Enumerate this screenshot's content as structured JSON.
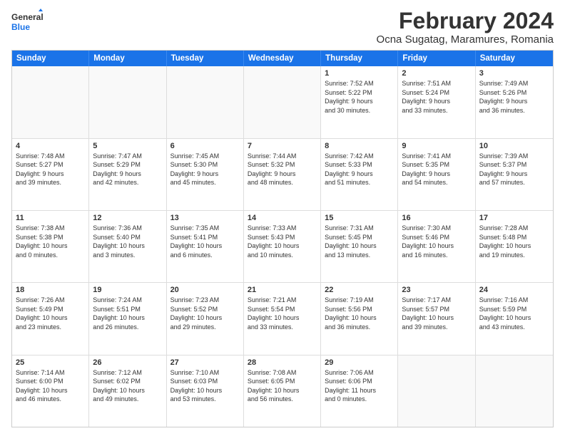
{
  "logo": {
    "line1": "General",
    "line2": "Blue"
  },
  "title": "February 2024",
  "subtitle": "Ocna Sugatag, Maramures, Romania",
  "headers": [
    "Sunday",
    "Monday",
    "Tuesday",
    "Wednesday",
    "Thursday",
    "Friday",
    "Saturday"
  ],
  "rows": [
    [
      {
        "day": "",
        "text": "",
        "empty": true
      },
      {
        "day": "",
        "text": "",
        "empty": true
      },
      {
        "day": "",
        "text": "",
        "empty": true
      },
      {
        "day": "",
        "text": "",
        "empty": true
      },
      {
        "day": "1",
        "text": "Sunrise: 7:52 AM\nSunset: 5:22 PM\nDaylight: 9 hours\nand 30 minutes.",
        "empty": false
      },
      {
        "day": "2",
        "text": "Sunrise: 7:51 AM\nSunset: 5:24 PM\nDaylight: 9 hours\nand 33 minutes.",
        "empty": false
      },
      {
        "day": "3",
        "text": "Sunrise: 7:49 AM\nSunset: 5:26 PM\nDaylight: 9 hours\nand 36 minutes.",
        "empty": false
      }
    ],
    [
      {
        "day": "4",
        "text": "Sunrise: 7:48 AM\nSunset: 5:27 PM\nDaylight: 9 hours\nand 39 minutes.",
        "empty": false
      },
      {
        "day": "5",
        "text": "Sunrise: 7:47 AM\nSunset: 5:29 PM\nDaylight: 9 hours\nand 42 minutes.",
        "empty": false
      },
      {
        "day": "6",
        "text": "Sunrise: 7:45 AM\nSunset: 5:30 PM\nDaylight: 9 hours\nand 45 minutes.",
        "empty": false
      },
      {
        "day": "7",
        "text": "Sunrise: 7:44 AM\nSunset: 5:32 PM\nDaylight: 9 hours\nand 48 minutes.",
        "empty": false
      },
      {
        "day": "8",
        "text": "Sunrise: 7:42 AM\nSunset: 5:33 PM\nDaylight: 9 hours\nand 51 minutes.",
        "empty": false
      },
      {
        "day": "9",
        "text": "Sunrise: 7:41 AM\nSunset: 5:35 PM\nDaylight: 9 hours\nand 54 minutes.",
        "empty": false
      },
      {
        "day": "10",
        "text": "Sunrise: 7:39 AM\nSunset: 5:37 PM\nDaylight: 9 hours\nand 57 minutes.",
        "empty": false
      }
    ],
    [
      {
        "day": "11",
        "text": "Sunrise: 7:38 AM\nSunset: 5:38 PM\nDaylight: 10 hours\nand 0 minutes.",
        "empty": false
      },
      {
        "day": "12",
        "text": "Sunrise: 7:36 AM\nSunset: 5:40 PM\nDaylight: 10 hours\nand 3 minutes.",
        "empty": false
      },
      {
        "day": "13",
        "text": "Sunrise: 7:35 AM\nSunset: 5:41 PM\nDaylight: 10 hours\nand 6 minutes.",
        "empty": false
      },
      {
        "day": "14",
        "text": "Sunrise: 7:33 AM\nSunset: 5:43 PM\nDaylight: 10 hours\nand 10 minutes.",
        "empty": false
      },
      {
        "day": "15",
        "text": "Sunrise: 7:31 AM\nSunset: 5:45 PM\nDaylight: 10 hours\nand 13 minutes.",
        "empty": false
      },
      {
        "day": "16",
        "text": "Sunrise: 7:30 AM\nSunset: 5:46 PM\nDaylight: 10 hours\nand 16 minutes.",
        "empty": false
      },
      {
        "day": "17",
        "text": "Sunrise: 7:28 AM\nSunset: 5:48 PM\nDaylight: 10 hours\nand 19 minutes.",
        "empty": false
      }
    ],
    [
      {
        "day": "18",
        "text": "Sunrise: 7:26 AM\nSunset: 5:49 PM\nDaylight: 10 hours\nand 23 minutes.",
        "empty": false
      },
      {
        "day": "19",
        "text": "Sunrise: 7:24 AM\nSunset: 5:51 PM\nDaylight: 10 hours\nand 26 minutes.",
        "empty": false
      },
      {
        "day": "20",
        "text": "Sunrise: 7:23 AM\nSunset: 5:52 PM\nDaylight: 10 hours\nand 29 minutes.",
        "empty": false
      },
      {
        "day": "21",
        "text": "Sunrise: 7:21 AM\nSunset: 5:54 PM\nDaylight: 10 hours\nand 33 minutes.",
        "empty": false
      },
      {
        "day": "22",
        "text": "Sunrise: 7:19 AM\nSunset: 5:56 PM\nDaylight: 10 hours\nand 36 minutes.",
        "empty": false
      },
      {
        "day": "23",
        "text": "Sunrise: 7:17 AM\nSunset: 5:57 PM\nDaylight: 10 hours\nand 39 minutes.",
        "empty": false
      },
      {
        "day": "24",
        "text": "Sunrise: 7:16 AM\nSunset: 5:59 PM\nDaylight: 10 hours\nand 43 minutes.",
        "empty": false
      }
    ],
    [
      {
        "day": "25",
        "text": "Sunrise: 7:14 AM\nSunset: 6:00 PM\nDaylight: 10 hours\nand 46 minutes.",
        "empty": false
      },
      {
        "day": "26",
        "text": "Sunrise: 7:12 AM\nSunset: 6:02 PM\nDaylight: 10 hours\nand 49 minutes.",
        "empty": false
      },
      {
        "day": "27",
        "text": "Sunrise: 7:10 AM\nSunset: 6:03 PM\nDaylight: 10 hours\nand 53 minutes.",
        "empty": false
      },
      {
        "day": "28",
        "text": "Sunrise: 7:08 AM\nSunset: 6:05 PM\nDaylight: 10 hours\nand 56 minutes.",
        "empty": false
      },
      {
        "day": "29",
        "text": "Sunrise: 7:06 AM\nSunset: 6:06 PM\nDaylight: 11 hours\nand 0 minutes.",
        "empty": false
      },
      {
        "day": "",
        "text": "",
        "empty": true
      },
      {
        "day": "",
        "text": "",
        "empty": true
      }
    ]
  ]
}
